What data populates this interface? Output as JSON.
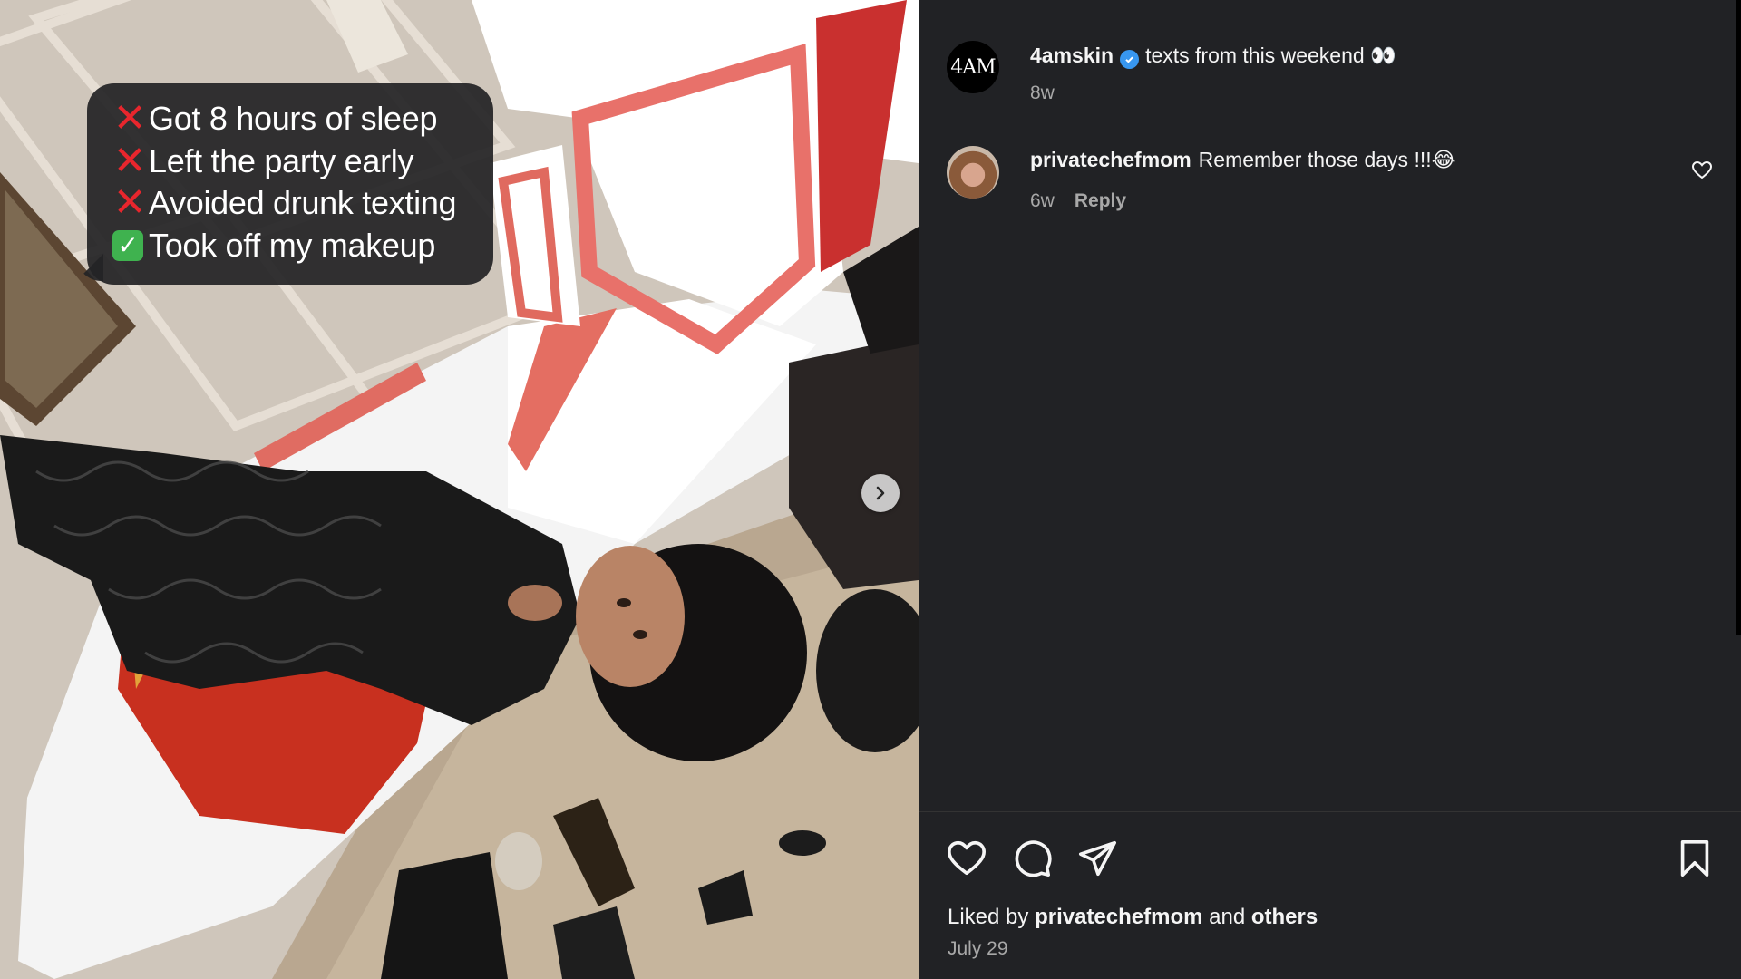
{
  "post": {
    "text_overlay": [
      {
        "mark": "cross",
        "mark_glyph": "✕",
        "text": "Got 8 hours of sleep"
      },
      {
        "mark": "cross",
        "mark_glyph": "✕",
        "text": "Left the party early"
      },
      {
        "mark": "cross",
        "mark_glyph": "✕",
        "text": "Avoided drunk texting"
      },
      {
        "mark": "check",
        "mark_glyph": "✓",
        "text": "Took off my makeup"
      }
    ],
    "next_icon": "chevron-right-icon"
  },
  "author": {
    "avatar_text": "4AM",
    "username": "4amskin",
    "verified": true,
    "caption": "texts from this weekend 👀",
    "time": "8w"
  },
  "comments": [
    {
      "username": "privatechefmom",
      "text": "Remember those days !!!😂",
      "time": "6w",
      "reply_label": "Reply"
    }
  ],
  "actions": {
    "like_icon": "heart-icon",
    "comment_icon": "comment-icon",
    "share_icon": "send-icon",
    "save_icon": "bookmark-icon"
  },
  "likes": {
    "prefix": "Liked by",
    "user": "privatechefmom",
    "conjunction": "and",
    "others": "others"
  },
  "date": "July 29",
  "colors": {
    "background": "#212225",
    "verified": "#3897f0",
    "cross": "#e8262d",
    "check": "#3fb24f",
    "muted_text": "#a8a8a8"
  }
}
